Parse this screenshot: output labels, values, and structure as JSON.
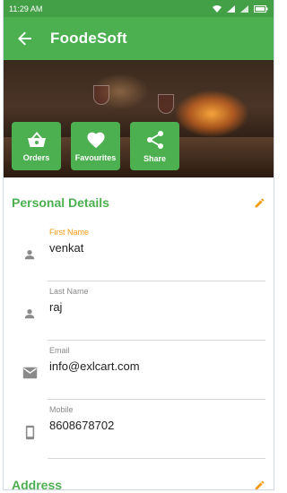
{
  "status_bar": {
    "time": "11:29 AM"
  },
  "app_bar": {
    "title": "FoodeSoft"
  },
  "actions": [
    {
      "label": "Orders",
      "icon": "basket-icon"
    },
    {
      "label": "Favourites",
      "icon": "heart-icon"
    },
    {
      "label": "Share",
      "icon": "share-icon"
    }
  ],
  "personal_details": {
    "title": "Personal Details",
    "fields": [
      {
        "label": "First Name",
        "value": "venkat",
        "icon": "person-icon",
        "active": true
      },
      {
        "label": "Last Name",
        "value": "raj",
        "icon": "person-icon",
        "active": false
      },
      {
        "label": "Email",
        "value": "info@exlcart.com",
        "icon": "mail-icon",
        "active": false
      },
      {
        "label": "Mobile",
        "value": "8608678702",
        "icon": "phone-icon",
        "active": false
      }
    ]
  },
  "address": {
    "title": "Address"
  },
  "colors": {
    "primary": "#4caf50",
    "status_bar": "#43a047",
    "accent_label": "#f39c12",
    "edit_icon": "#f39c12"
  }
}
